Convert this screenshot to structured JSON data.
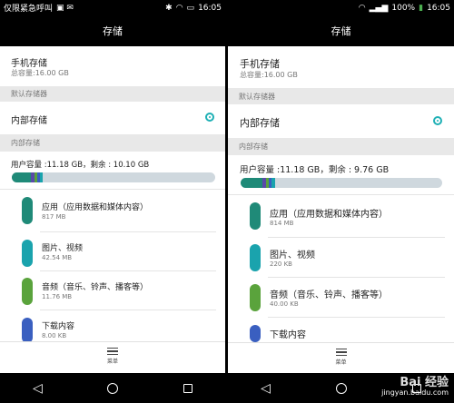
{
  "left": {
    "status": {
      "carrier": "仅限紧急呼叫",
      "time": "16:05"
    },
    "title": "存储",
    "phone_storage": {
      "label": "手机存储",
      "total": "总容量:16.00 GB"
    },
    "default_section": "默认存储器",
    "default_item": "内部存储",
    "internal_section": "内部存储",
    "usage": "用户容量 :11.18 GB，剩余 : 10.10 GB",
    "items": [
      {
        "label": "应用（应用数据和媒体内容）",
        "size": "817 MB",
        "color": "#1f8a78"
      },
      {
        "label": "图片、视频",
        "size": "42.54 MB",
        "color": "#1aa3ad"
      },
      {
        "label": "音频（音乐、铃声、播客等）",
        "size": "11.76 MB",
        "color": "#5aa33c"
      },
      {
        "label": "下载内容",
        "size": "8.00 KB",
        "color": "#3a5fc0"
      }
    ],
    "menu_label": "菜单"
  },
  "right": {
    "status": {
      "battery": "100%",
      "time": "16:05"
    },
    "title": "存储",
    "phone_storage": {
      "label": "手机存储",
      "total": "总容量:16.00 GB"
    },
    "default_section": "默认存储器",
    "default_item": "内部存储",
    "internal_section": "内部存储",
    "usage": "用户容量 :11.18 GB，剩余 : 9.76 GB",
    "items": [
      {
        "label": "应用（应用数据和媒体内容）",
        "size": "814 MB",
        "color": "#1f8a78"
      },
      {
        "label": "图片、视频",
        "size": "220 KB",
        "color": "#1aa3ad"
      },
      {
        "label": "音频（音乐、铃声、播客等）",
        "size": "40.00 KB",
        "color": "#5aa33c"
      },
      {
        "label": "下载内容",
        "size": "",
        "color": "#3a5fc0"
      }
    ],
    "menu_label": "菜单",
    "watermark": {
      "brand": "Bai 经验",
      "url": "jingyan.baidu.com"
    }
  },
  "colors": {
    "accent": "#1fb0b5",
    "bar_track": "#cfd8de"
  }
}
